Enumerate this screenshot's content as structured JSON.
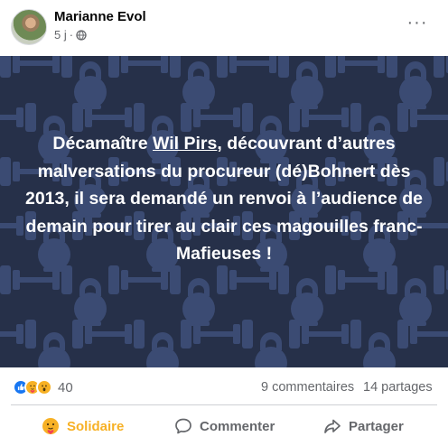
{
  "post": {
    "author": "Marianne Evol",
    "time": "5 j",
    "separator": "·",
    "more_label": "···"
  },
  "image": {
    "background_color": "#263049",
    "pattern_color": "#3b4b73",
    "pattern_icons": [
      "dumbbell-icon",
      "kettlebell-icon"
    ],
    "text_before": "Décamaître ",
    "mention": "Wil Pirs",
    "text_after": ", découvrant d’autres malversations du procureur (dé)Bohnert dès 2013, il sera demandé un renvoi à l’audience de demain pour tirer au clair ces magouilles franc-Mafieuses !"
  },
  "stats": {
    "reaction_icons": [
      "like-icon",
      "care-icon",
      "wow-icon"
    ],
    "reaction_count": "40",
    "comments": "9 commentaires",
    "shares": "14 partages"
  },
  "actions": {
    "react_label": "Solidaire",
    "comment_label": "Commenter",
    "share_label": "Partager"
  },
  "colors": {
    "accent": "#f7b125",
    "like_blue": "#1877f2",
    "secondary_text": "#65676b"
  }
}
